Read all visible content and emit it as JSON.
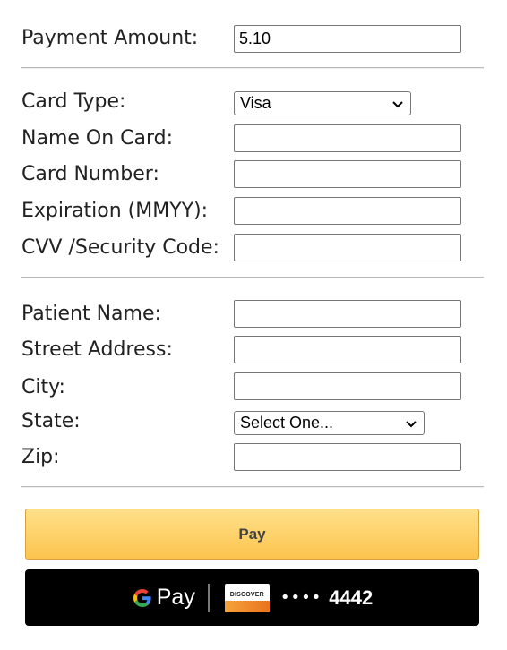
{
  "payment": {
    "amount_label": "Payment Amount:",
    "amount_value": "5.10"
  },
  "card": {
    "type_label": "Card Type:",
    "type_value": "Visa",
    "name_label": "Name On Card:",
    "name_value": "",
    "number_label": "Card Number:",
    "number_value": "",
    "expiration_label": "Expiration (MMYY):",
    "expiration_value": "",
    "cvv_label": "CVV /Security Code:",
    "cvv_value": ""
  },
  "patient": {
    "name_label": "Patient Name:",
    "name_value": "",
    "street_label": "Street Address:",
    "street_value": "",
    "city_label": "City:",
    "city_value": "",
    "state_label": "State:",
    "state_value": "Select One...",
    "zip_label": "Zip:",
    "zip_value": ""
  },
  "actions": {
    "pay_label": "Pay",
    "gpay_text": "Pay",
    "gpay_card_brand": "DISCOVER",
    "gpay_card_mask": "••••",
    "gpay_card_last4": "4442"
  },
  "colors": {
    "pay_button": "#fcc44e",
    "gpay_background": "#000000",
    "discover_orange": "#f6a23a"
  },
  "icons": [
    "chevron-down-icon",
    "google-g-icon",
    "discover-card-icon"
  ]
}
